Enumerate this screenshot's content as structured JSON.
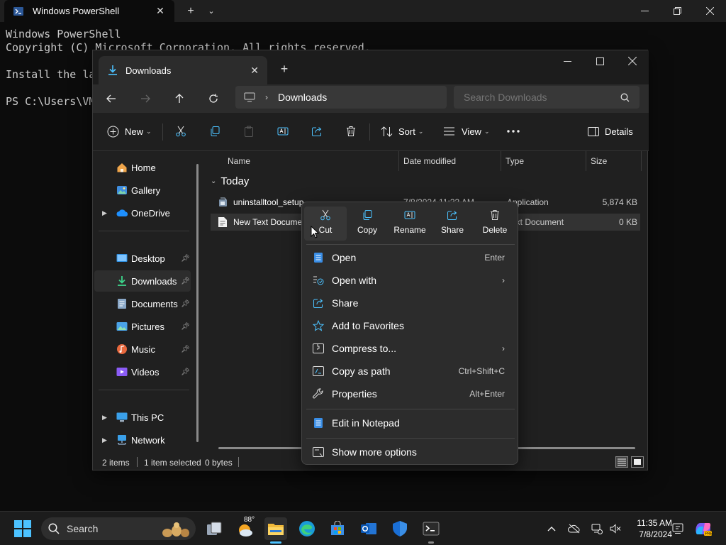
{
  "terminal": {
    "tab_title": "Windows PowerShell",
    "lines": [
      "Windows PowerShell",
      "Copyright (C) Microsoft Corporation. All rights reserved.",
      "",
      "Install the la",
      "",
      "PS C:\\Users\\VM"
    ]
  },
  "explorer": {
    "tab_title": "Downloads",
    "address": {
      "crumb": "Downloads"
    },
    "search": {
      "placeholder": "Search Downloads"
    },
    "toolbar": {
      "new_label": "New",
      "sort_label": "Sort",
      "view_label": "View",
      "details_label": "Details"
    },
    "nav": {
      "items": [
        {
          "label": "Home",
          "icon": "home-icon"
        },
        {
          "label": "Gallery",
          "icon": "gallery-icon"
        },
        {
          "label": "OneDrive",
          "icon": "cloud-icon"
        },
        {
          "label": "Desktop",
          "icon": "desktop-icon"
        },
        {
          "label": "Downloads",
          "icon": "download-icon"
        },
        {
          "label": "Documents",
          "icon": "documents-icon"
        },
        {
          "label": "Pictures",
          "icon": "pictures-icon"
        },
        {
          "label": "Music",
          "icon": "music-icon"
        },
        {
          "label": "Videos",
          "icon": "videos-icon"
        },
        {
          "label": "This PC",
          "icon": "pc-icon"
        },
        {
          "label": "Network",
          "icon": "network-icon"
        }
      ]
    },
    "columns": {
      "name": "Name",
      "date": "Date modified",
      "type": "Type",
      "size": "Size"
    },
    "group": "Today",
    "files": [
      {
        "name": "uninstalltool_setup",
        "date": "7/8/2024 11:33 AM",
        "type": "Application",
        "size": "5,874 KB"
      },
      {
        "name": "New Text Document",
        "date": "",
        "type": "Text Document",
        "size": "0 KB"
      }
    ],
    "status": {
      "items": "2 items",
      "selected": "1 item selected",
      "bytes": "0 bytes"
    }
  },
  "context_menu": {
    "top_actions": [
      {
        "label": "Cut",
        "icon": "scissors-icon"
      },
      {
        "label": "Copy",
        "icon": "copy-icon"
      },
      {
        "label": "Rename",
        "icon": "rename-icon"
      },
      {
        "label": "Share",
        "icon": "share-icon"
      },
      {
        "label": "Delete",
        "icon": "trash-icon"
      }
    ],
    "items": [
      {
        "label": "Open",
        "shortcut": "Enter",
        "icon": "notepad-icon"
      },
      {
        "label": "Open with",
        "shortcut": "",
        "icon": "open-with-icon"
      },
      {
        "label": "Share",
        "shortcut": "",
        "icon": "share-icon"
      },
      {
        "label": "Add to Favorites",
        "shortcut": "",
        "icon": "star-icon"
      },
      {
        "label": "Compress to...",
        "shortcut": "",
        "icon": "zip-icon"
      },
      {
        "label": "Copy as path",
        "shortcut": "Ctrl+Shift+C",
        "icon": "path-icon"
      },
      {
        "label": "Properties",
        "shortcut": "Alt+Enter",
        "icon": "wrench-icon"
      },
      {
        "label": "Edit in Notepad",
        "shortcut": "",
        "icon": "notepad-icon"
      },
      {
        "label": "Show more options",
        "shortcut": "",
        "icon": "more-options-icon"
      }
    ]
  },
  "taskbar": {
    "search_label": "Search",
    "weather_temp": "88°",
    "time": "11:35 AM",
    "date": "7/8/2024"
  },
  "colors": {
    "terminal_bg": "#0c0c0c",
    "explorer_bg": "#202020",
    "menu_bg": "#2c2c2c",
    "accent": "#4cc2ff",
    "taskbar_bg": "#1c1c1c"
  }
}
